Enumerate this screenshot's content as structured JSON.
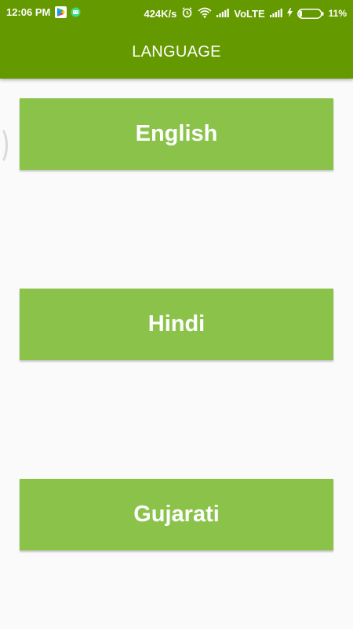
{
  "status_bar": {
    "time": "12:06 PM",
    "net_speed": "424K/s",
    "network_label": "VoLTE",
    "battery_percent": "11%",
    "icons": [
      "play-store-icon",
      "android-icon",
      "alarm-icon",
      "wifi-icon",
      "signal-icon",
      "charging-icon",
      "battery-icon"
    ]
  },
  "app_bar": {
    "title": "LANGUAGE",
    "color": "#659900"
  },
  "languages": {
    "button_color": "#8bc34a",
    "items": [
      {
        "label": "English"
      },
      {
        "label": "Hindi"
      },
      {
        "label": "Gujarati"
      }
    ]
  }
}
